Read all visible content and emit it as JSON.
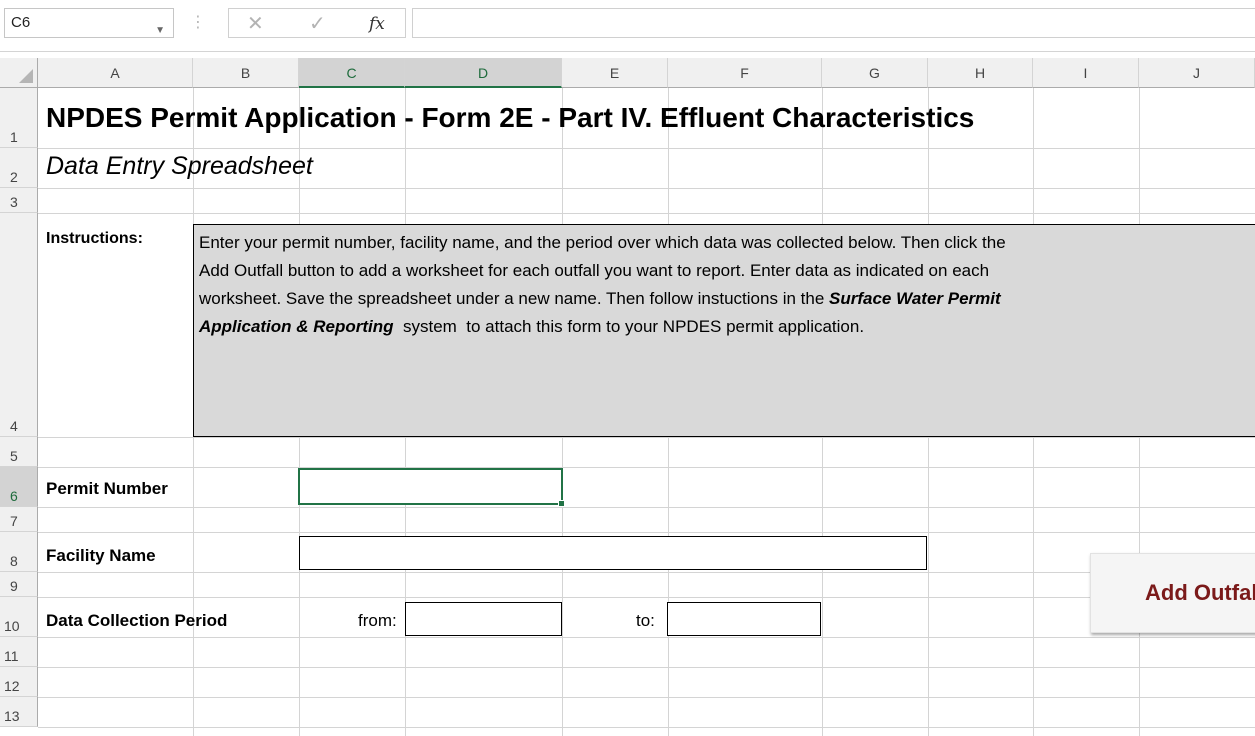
{
  "formula_bar": {
    "name_box": "C6",
    "cancel_icon": "✕",
    "enter_icon": "✓",
    "fx_icon": "fx",
    "formula": ""
  },
  "columns": [
    "A",
    "B",
    "C",
    "D",
    "E",
    "F",
    "G",
    "H",
    "I",
    "J"
  ],
  "selected_columns": [
    "C",
    "D"
  ],
  "rows": [
    "1",
    "2",
    "3",
    "4",
    "5",
    "6",
    "7",
    "8",
    "9",
    "10",
    "11",
    "12",
    "13"
  ],
  "selected_row": "6",
  "sheet": {
    "title": "NPDES Permit Application - Form 2E - Part IV. Effluent Characteristics",
    "subtitle": "Data Entry Spreadsheet",
    "instructions_label": "Instructions:",
    "instructions": {
      "line1": "Enter your permit number, facility name, and the period over which data was collected below.  Then click the",
      "line2": "Add Outfall button to add a worksheet for each outfall you want to report.  Enter data as indicated on each",
      "line3_pre": "worksheet.  Save the spreadsheet under a new name.  Then follow instuctions in the ",
      "line3_bold": "Surface Water Permit",
      "line4_bold": "Application & Reporting",
      "line4_post": "  system  to attach this form to your NPDES permit application."
    },
    "permit_number_label": "Permit Number",
    "permit_number_value": "",
    "facility_name_label": "Facility Name",
    "facility_name_value": "",
    "period_label": "Data Collection Period",
    "from_label": "from:",
    "from_value": "",
    "to_label": "to:",
    "to_value": "",
    "add_outfall_button": "Add Outfall"
  },
  "colors": {
    "selection": "#217346",
    "button_text": "#7b1a1a",
    "instructions_bg": "#d9d9d9"
  }
}
